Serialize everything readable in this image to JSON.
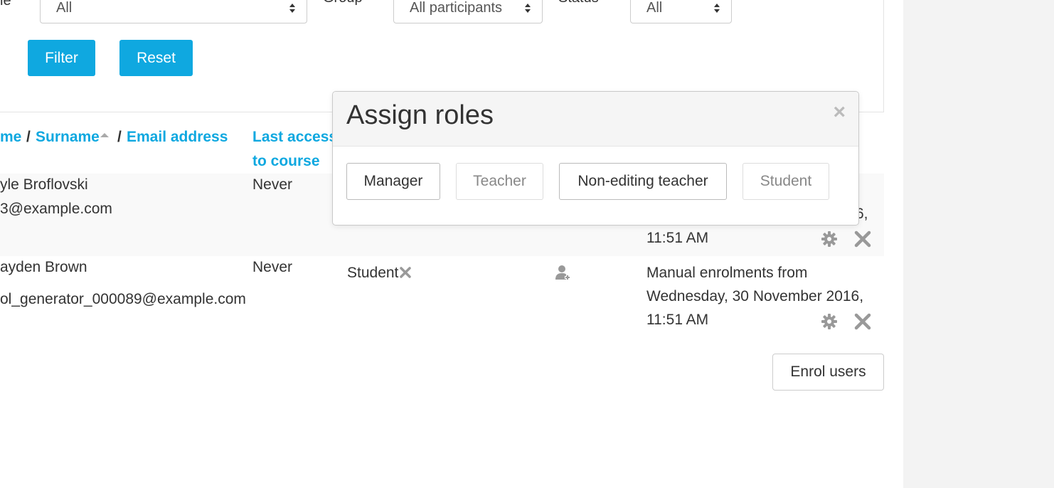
{
  "filters": {
    "role_label_partial": "le",
    "role_value": "All",
    "group_label": "Group",
    "group_value": "All participants",
    "status_label": "Status",
    "status_value": "All",
    "filter_button": "Filter",
    "reset_button": "Reset"
  },
  "table": {
    "header": {
      "name_partial": "me",
      "sep1": "/",
      "surname": "Surname",
      "sep2": "/",
      "email": "Email address",
      "last_access_line1": "Last access",
      "last_access_line2": "to course"
    },
    "rows": [
      {
        "name": "yle Broflovski",
        "email": "3@example.com",
        "last_access": "Never",
        "enrol_partial": "6,",
        "enrol_time": "11:51 AM"
      },
      {
        "name": "ayden Brown",
        "email": "ol_generator_000089@example.com",
        "last_access": "Never",
        "role": "Student",
        "enrol_line1": "Manual enrolments from",
        "enrol_line2": "Wednesday, 30 November 2016,",
        "enrol_line3": "11:51 AM"
      }
    ],
    "enrol_users_button": "Enrol users"
  },
  "modal": {
    "title": "Assign roles",
    "close": "×",
    "roles": [
      {
        "label": "Manager",
        "enabled": true
      },
      {
        "label": "Teacher",
        "enabled": false
      },
      {
        "label": "Non-editing teacher",
        "enabled": true
      },
      {
        "label": "Student",
        "enabled": false
      }
    ]
  },
  "colors": {
    "link": "#0fa8e0",
    "primary_button": "#0fa8e0",
    "muted_icon": "#999999",
    "gutter": "#f3f3f3"
  },
  "icons": {
    "remove_role": "x-icon",
    "assign_role": "user-plus-icon",
    "edit_enrolment": "gear-icon",
    "unenrol": "x-icon",
    "select_caret": "updown-caret-icon"
  }
}
